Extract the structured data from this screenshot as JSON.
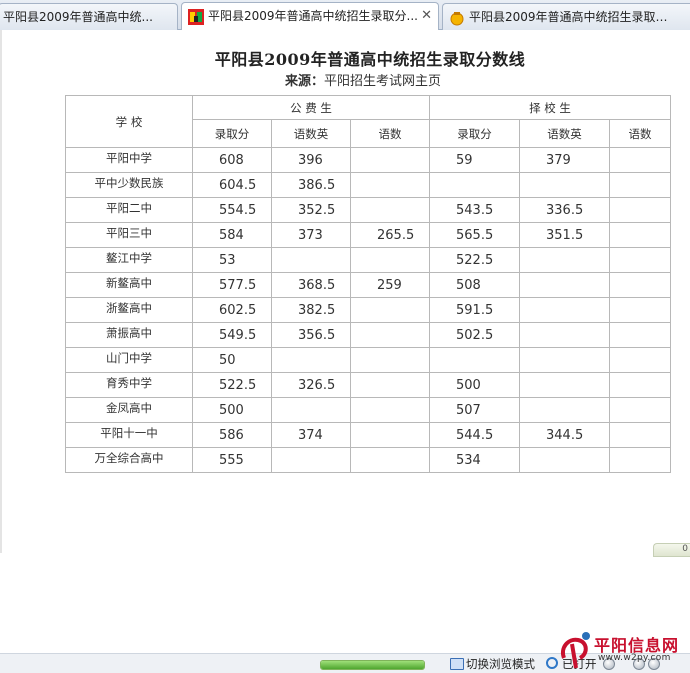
{
  "tabs": [
    {
      "title": "平阳县2009年普通高中统...",
      "active": false
    },
    {
      "title": "平阳县2009年普通高中统招生录取分...",
      "active": true
    },
    {
      "title": "平阳县2009年普通高中统招生录取分...",
      "active": false
    }
  ],
  "tab_close_glyph": "✕",
  "page": {
    "title": "平阳县2009年普通高中统招生录取分数线",
    "source_label": "来源：",
    "source_link": "平阳招生考试网主页"
  },
  "table": {
    "school_header": "学 校",
    "groups": [
      "公 费 生",
      "择 校 生"
    ],
    "subheaders": [
      "录取分",
      "语数英",
      "语数",
      "录取分",
      "语数英",
      "语数"
    ],
    "rows": [
      {
        "school": "平阳中学",
        "values": [
          "608",
          "396",
          "",
          "59",
          "379",
          ""
        ]
      },
      {
        "school": "平中少数民族",
        "values": [
          "604.5",
          "386.5",
          "",
          "",
          "",
          ""
        ]
      },
      {
        "school": "平阳二中",
        "values": [
          "554.5",
          "352.5",
          "",
          "543.5",
          "336.5",
          ""
        ]
      },
      {
        "school": "平阳三中",
        "values": [
          "584",
          "373",
          "265.5",
          "565.5",
          "351.5",
          ""
        ]
      },
      {
        "school": "鳌江中学",
        "values": [
          "53",
          "",
          "",
          "522.5",
          "",
          ""
        ]
      },
      {
        "school": "新鳌高中",
        "values": [
          "577.5",
          "368.5",
          "259",
          "508",
          "",
          ""
        ]
      },
      {
        "school": "浙鳌高中",
        "values": [
          "602.5",
          "382.5",
          "",
          "591.5",
          "",
          ""
        ]
      },
      {
        "school": "萧振高中",
        "values": [
          "549.5",
          "356.5",
          "",
          "502.5",
          "",
          ""
        ]
      },
      {
        "school": "山门中学",
        "values": [
          "50",
          "",
          "",
          "",
          "",
          ""
        ]
      },
      {
        "school": "育秀中学",
        "values": [
          "522.5",
          "326.5",
          "",
          "500",
          "",
          ""
        ]
      },
      {
        "school": "金凤高中",
        "values": [
          "500",
          "",
          "",
          "507",
          "",
          ""
        ]
      },
      {
        "school": "平阳十一中",
        "values": [
          "586",
          "374",
          "",
          "544.5",
          "344.5",
          ""
        ]
      },
      {
        "school": "万全综合高中",
        "values": [
          "555",
          "",
          "",
          "534",
          "",
          ""
        ]
      }
    ]
  },
  "scroll_hint": "0",
  "status": {
    "progress": 1.0,
    "browse_mode": "切换浏览模式",
    "open_label": "已打开"
  },
  "watermark": {
    "name": "平阳信息网",
    "url": "www.w2py.com"
  },
  "colors": {
    "progress_green": "#4fa62f",
    "watermark_red": "#c8102e",
    "table_border": "#b8b8b8"
  }
}
